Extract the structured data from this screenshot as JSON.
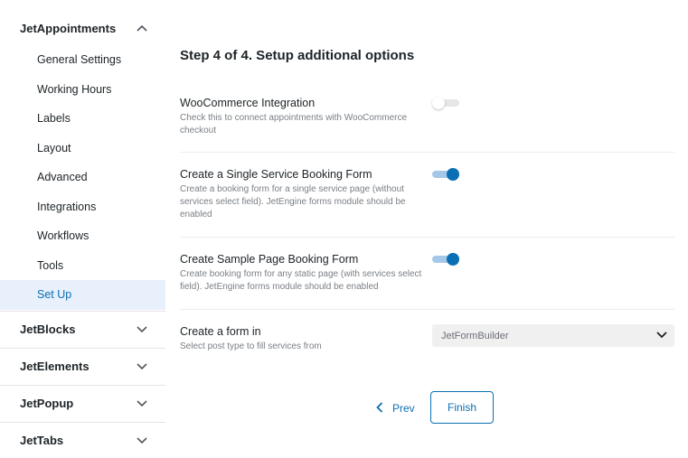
{
  "sidebar": {
    "groups": [
      {
        "label": "JetAppointments",
        "icon": "chevron-up-icon"
      },
      {
        "label": "JetBlocks",
        "icon": "chevron-down-icon"
      },
      {
        "label": "JetElements",
        "icon": "chevron-down-icon"
      },
      {
        "label": "JetPopup",
        "icon": "chevron-down-icon"
      },
      {
        "label": "JetTabs",
        "icon": "chevron-down-icon"
      }
    ],
    "items": [
      {
        "label": "General Settings"
      },
      {
        "label": "Working Hours"
      },
      {
        "label": "Labels"
      },
      {
        "label": "Layout"
      },
      {
        "label": "Advanced"
      },
      {
        "label": "Integrations"
      },
      {
        "label": "Workflows"
      },
      {
        "label": "Tools"
      },
      {
        "label": "Set Up",
        "active": true
      }
    ]
  },
  "main": {
    "title": "Step 4 of 4. Setup additional options",
    "options": [
      {
        "label": "WooCommerce Integration",
        "description": "Check this to connect appointments with WooCommerce checkout",
        "enabled": false
      },
      {
        "label": "Create a Single Service Booking Form",
        "description": "Create a booking form for a single service page (without services select field). JetEngine forms module should be enabled",
        "enabled": true
      },
      {
        "label": "Create Sample Page Booking Form",
        "description": "Create booking form for any static page (with services select field). JetEngine forms module should be enabled",
        "enabled": true
      }
    ],
    "form_in": {
      "label": "Create a form in",
      "description": "Select post type to fill services from",
      "selected": "JetFormBuilder"
    },
    "prev_label": "Prev",
    "finish_label": "Finish"
  },
  "colors": {
    "accent": "#0b6fb3",
    "active_bg": "#e8f0fc",
    "toggle_on_track": "#a6c8e8"
  }
}
